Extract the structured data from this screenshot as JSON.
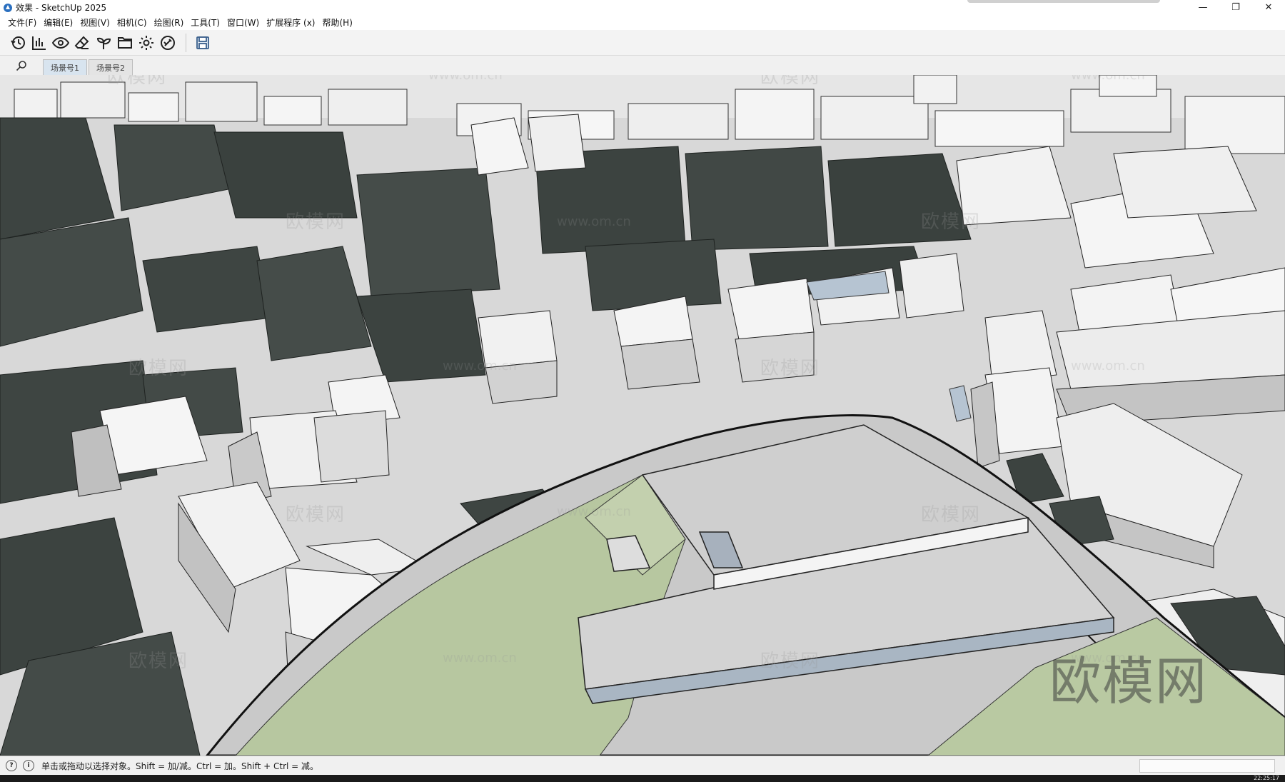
{
  "window": {
    "title": "效果 - SketchUp 2025",
    "minimize": "—",
    "restore": "❐",
    "close": "✕"
  },
  "menu": [
    {
      "label": "文件(F)"
    },
    {
      "label": "编辑(E)"
    },
    {
      "label": "视图(V)"
    },
    {
      "label": "相机(C)"
    },
    {
      "label": "绘图(R)"
    },
    {
      "label": "工具(T)"
    },
    {
      "label": "窗口(W)"
    },
    {
      "label": "扩展程序 (x)"
    },
    {
      "label": "帮助(H)"
    }
  ],
  "toolbar": {
    "icons": [
      "history-icon",
      "chart-icon",
      "eye-icon",
      "eraser-icon",
      "sprout-icon",
      "folder-icon",
      "gear-icon",
      "brush-icon",
      "save-icon"
    ]
  },
  "scenes": {
    "tabs": [
      {
        "label": "场景号1",
        "active": true
      },
      {
        "label": "场景号2",
        "active": false
      }
    ]
  },
  "watermarks": {
    "brand": "欧模网",
    "url": "www.om.cn"
  },
  "status": {
    "hint": "单击或拖动以选择对象。Shift = 加/减。Ctrl = 加。Shift + Ctrl = 减。"
  },
  "taskbar": {
    "clock": "22:25:17"
  },
  "colors": {
    "sky": "#e8e8e8",
    "ground": "#d6d6d6",
    "grass": "#b9c9a2",
    "roof_dark": "#3c4340",
    "wall_white": "#f2f2f2",
    "wall_shade": "#b4b4b4",
    "glass_blue": "#b6c4d2"
  }
}
